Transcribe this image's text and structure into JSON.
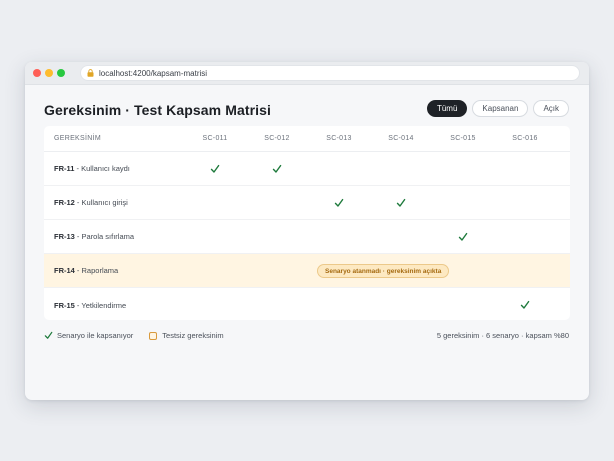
{
  "browser": {
    "url": "localhost:4200/kapsam-matrisi"
  },
  "page": {
    "title": "Gereksinim · Test Kapsam Matrisi"
  },
  "filters": [
    {
      "label": "Tümü",
      "active": true
    },
    {
      "label": "Kapsanan",
      "active": false
    },
    {
      "label": "Açık",
      "active": false
    }
  ],
  "table": {
    "header_requirement": "GEREKSİNİM",
    "scenarios": [
      "SC-011",
      "SC-012",
      "SC-013",
      "SC-014",
      "SC-015",
      "SC-016"
    ],
    "rows": [
      {
        "id": "FR-11",
        "name": "Kullanıcı kaydı",
        "covered": [
          "SC-011",
          "SC-012"
        ]
      },
      {
        "id": "FR-12",
        "name": "Kullanıcı girişi",
        "covered": [
          "SC-013",
          "SC-014"
        ]
      },
      {
        "id": "FR-13",
        "name": "Parola sıfırlama",
        "covered": [
          "SC-015"
        ]
      },
      {
        "id": "FR-14",
        "name": "Raporlama",
        "covered": [],
        "warning": "Senaryo atanmadı · gereksinim açıkta"
      },
      {
        "id": "FR-15",
        "name": "Yetkilendirme",
        "covered": [
          "SC-016"
        ]
      }
    ]
  },
  "legend": {
    "covered": "Senaryo ile kapsanıyor",
    "untested": "Testsiz gereksinim"
  },
  "summary": "5 gereksinim · 6 senaryo · kapsam %80",
  "colors": {
    "check": "#1e7a3c",
    "highlight_row": "#fff5e2",
    "warning_text": "#a56a10",
    "active_filter": "#1f2227"
  }
}
